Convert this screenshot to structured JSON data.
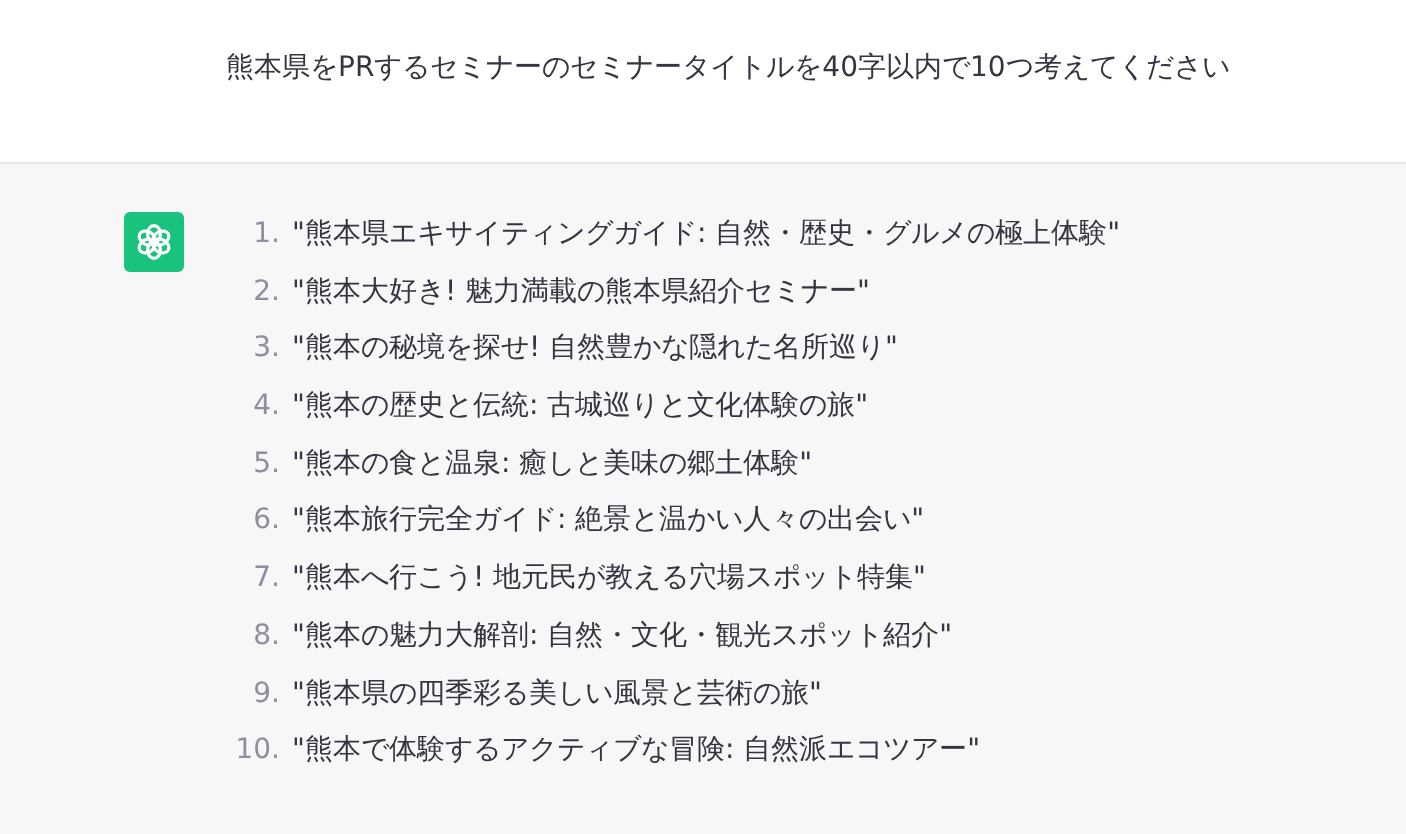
{
  "prompt": {
    "text": "熊本県をPRするセミナーのセミナータイトルを40字以内で10つ考えてください"
  },
  "response": {
    "items": [
      {
        "number": "1.",
        "text": "\"熊本県エキサイティングガイド: 自然・歴史・グルメの極上体験\""
      },
      {
        "number": "2.",
        "text": "\"熊本大好き! 魅力満載の熊本県紹介セミナー\""
      },
      {
        "number": "3.",
        "text": "\"熊本の秘境を探せ! 自然豊かな隠れた名所巡り\""
      },
      {
        "number": "4.",
        "text": "\"熊本の歴史と伝統: 古城巡りと文化体験の旅\""
      },
      {
        "number": "5.",
        "text": "\"熊本の食と温泉: 癒しと美味の郷土体験\""
      },
      {
        "number": "6.",
        "text": "\"熊本旅行完全ガイド: 絶景と温かい人々の出会い\""
      },
      {
        "number": "7.",
        "text": "\"熊本へ行こう! 地元民が教える穴場スポット特集\""
      },
      {
        "number": "8.",
        "text": "\"熊本の魅力大解剖: 自然・文化・観光スポット紹介\""
      },
      {
        "number": "9.",
        "text": "\"熊本県の四季彩る美しい風景と芸術の旅\""
      },
      {
        "number": "10.",
        "text": "\"熊本で体験するアクティブな冒険: 自然派エコツアー\""
      }
    ]
  }
}
